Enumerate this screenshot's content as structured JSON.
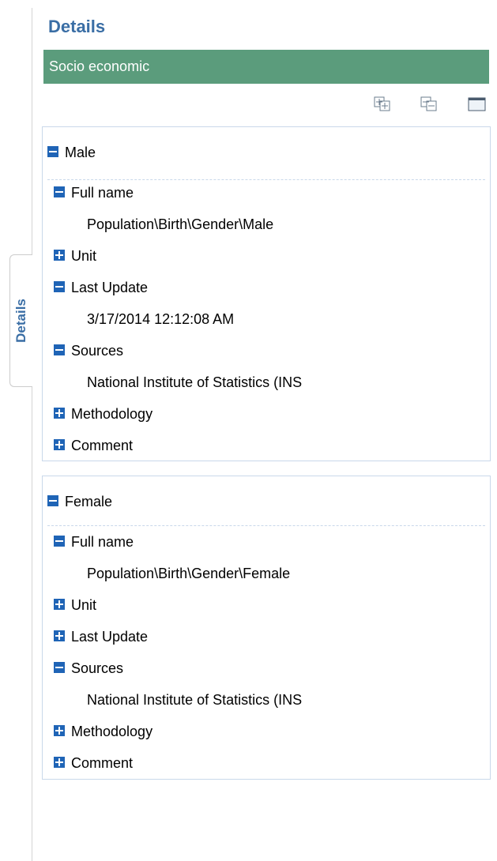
{
  "side_tab": {
    "label": "Details"
  },
  "panel": {
    "title": "Details",
    "group": "Socio economic"
  },
  "toolbar": {
    "buttons": [
      {
        "icon": "expand-all-icon"
      },
      {
        "icon": "collapse-all-icon"
      },
      {
        "icon": "window-icon"
      }
    ]
  },
  "items": [
    {
      "name": "Male",
      "fields": {
        "full_name": {
          "label": "Full name",
          "value": "Population\\Birth\\Gender\\Male"
        },
        "unit": {
          "label": "Unit"
        },
        "last_update": {
          "label": "Last Update",
          "value": "3/17/2014 12:12:08 AM"
        },
        "sources": {
          "label": "Sources",
          "value": "National Institute of Statistics (INS"
        },
        "methodology": {
          "label": "Methodology"
        },
        "comment": {
          "label": "Comment"
        }
      }
    },
    {
      "name": "Female",
      "fields": {
        "full_name": {
          "label": "Full name",
          "value": "Population\\Birth\\Gender\\Female"
        },
        "unit": {
          "label": "Unit"
        },
        "last_update": {
          "label": "Last Update"
        },
        "sources": {
          "label": "Sources",
          "value": "National Institute of Statistics (INS"
        },
        "methodology": {
          "label": "Methodology"
        },
        "comment": {
          "label": "Comment"
        }
      }
    }
  ],
  "colors": {
    "title": "#3a6ea5",
    "group_bar": "#5b9c7c",
    "toggle": "#1f64b6",
    "box_border": "#c9d8ea"
  }
}
